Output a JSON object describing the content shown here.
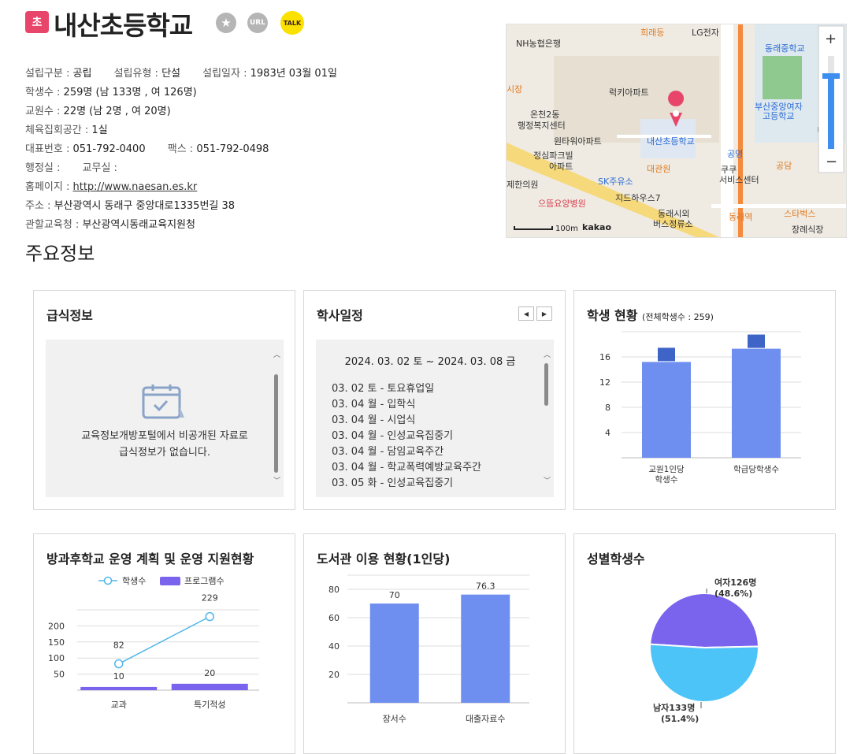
{
  "header": {
    "badge": "초",
    "school_name": "내산초등학교",
    "url_label": "URL",
    "talk_label": "TALK"
  },
  "info": {
    "type_label": "설립구분 :",
    "type_value": "공립",
    "kind_label": "설립유형 :",
    "kind_value": "단설",
    "date_label": "설립일자 :",
    "date_value": "1983년 03월 01일",
    "students_label": "학생수 :",
    "students_value": "259명 (남 133명 , 여 126명)",
    "teachers_label": "교원수 :",
    "teachers_value": "22명 (남 2명 , 여 20명)",
    "gym_label": "체육집회공간 :",
    "gym_value": "1실",
    "phone_label": "대표번호 :",
    "phone_value": "051-792-0400",
    "fax_label": "팩스 :",
    "fax_value": "051-792-0498",
    "admin_label": "행정실 :",
    "staff_label": "교무실 :",
    "home_label": "홈페이지 :",
    "home_value": "http://www.naesan.es.kr",
    "addr_label": "주소 :",
    "addr_value": "부산광역시 동래구 중앙대로1335번길 38",
    "office_label": "관할교육청 :",
    "office_value": "부산광역시동래교육지원청"
  },
  "map": {
    "labels": {
      "nh": "NH농협은행",
      "heraedeung": "희래등",
      "lg": "LG전자",
      "dongnae_middle": "동래중학교",
      "sijang": "시장",
      "lucky": "럭키아파트",
      "busan_girls1": "부산중앙여자",
      "busan_girls2": "고등학교",
      "oncheon1": "온천2동",
      "oncheon2": "행정복지센터",
      "school": "내산초등학교",
      "wontower": "원타워아파트",
      "jeongsim1": "정심파크빌",
      "jeongsim2": "아파트",
      "daegwan": "대관원",
      "gongyeong": "공영",
      "kuku1": "쿠쿠",
      "kuku2": "서비스센터",
      "gongdam": "공담",
      "hanuiwon": "제한의원",
      "sk": "SK주유소",
      "jidreu": "지드하우스7",
      "oneum": "으뜸요양병원",
      "dongnae_station": "동래역",
      "starbucks": "스타벅스",
      "bus1": "동래시외",
      "bus2": "버스정류소",
      "jangrae": "장례식장",
      "scale": "100m",
      "kakao": "kakao",
      "mi": "미",
      "plus": "+",
      "minus": "−"
    }
  },
  "main_title": "주요정보",
  "meal": {
    "title": "급식정보",
    "message_line1": "교육정보개방포털에서 비공개된 자료로",
    "message_line2": "급식정보가 없습니다."
  },
  "calendar": {
    "title": "학사일정",
    "range": "2024. 03. 02 토 ~ 2024. 03. 08 금",
    "events": [
      "03. 02 토 - 토요휴업일",
      "03. 04 월 - 입학식",
      "03. 04 월 - 시업식",
      "03. 04 월 - 인성교육집중기",
      "03. 04 월 - 담임교육주간",
      "03. 04 월 - 학교폭력예방교육주간",
      "03. 05 화 - 인성교육집중기"
    ]
  },
  "student_status": {
    "title": "학생 현황",
    "subtitle": "(전체학생수 : 259)"
  },
  "afterschool": {
    "title": "방과후학교 운영 계획 및 운영 지원현황"
  },
  "library": {
    "title": "도서관 이용 현황(1인당)"
  },
  "gender": {
    "title": "성별학생수"
  },
  "colors": {
    "bar": "#6f8ff0",
    "bar_label": "#3e64c8",
    "line": "#4fb6ea",
    "purple": "#7a64ee",
    "cyan": "#4dc4f8"
  },
  "chart_data": [
    {
      "type": "bar",
      "name": "student_status",
      "categories": [
        "교원1인당\n학생수",
        "학급당학생수"
      ],
      "values": [
        15.2,
        17.3
      ],
      "yticks": [
        4,
        8,
        12,
        16
      ],
      "ylim": [
        0,
        20
      ]
    },
    {
      "type": "bar+line",
      "name": "afterschool",
      "categories": [
        "교과",
        "특기적성"
      ],
      "series": [
        {
          "name": "학생수",
          "type": "line",
          "values": [
            82,
            229
          ]
        },
        {
          "name": "프로그램수",
          "type": "bar",
          "values": [
            10,
            20
          ]
        }
      ],
      "yticks": [
        50,
        100,
        150,
        200
      ],
      "ylim": [
        0,
        250
      ],
      "legend": "top"
    },
    {
      "type": "bar",
      "name": "library",
      "categories": [
        "장서수",
        "대출자료수"
      ],
      "values": [
        70,
        76.3
      ],
      "value_labels": [
        "70",
        "76.3"
      ],
      "yticks": [
        20,
        40,
        60,
        80
      ],
      "ylim": [
        0,
        90
      ]
    },
    {
      "type": "pie",
      "name": "gender",
      "slices": [
        {
          "label": "여자126명",
          "pct": "(48.6%)",
          "value": 126
        },
        {
          "label": "남자133명",
          "pct": "(51.4%)",
          "value": 133
        }
      ]
    }
  ]
}
